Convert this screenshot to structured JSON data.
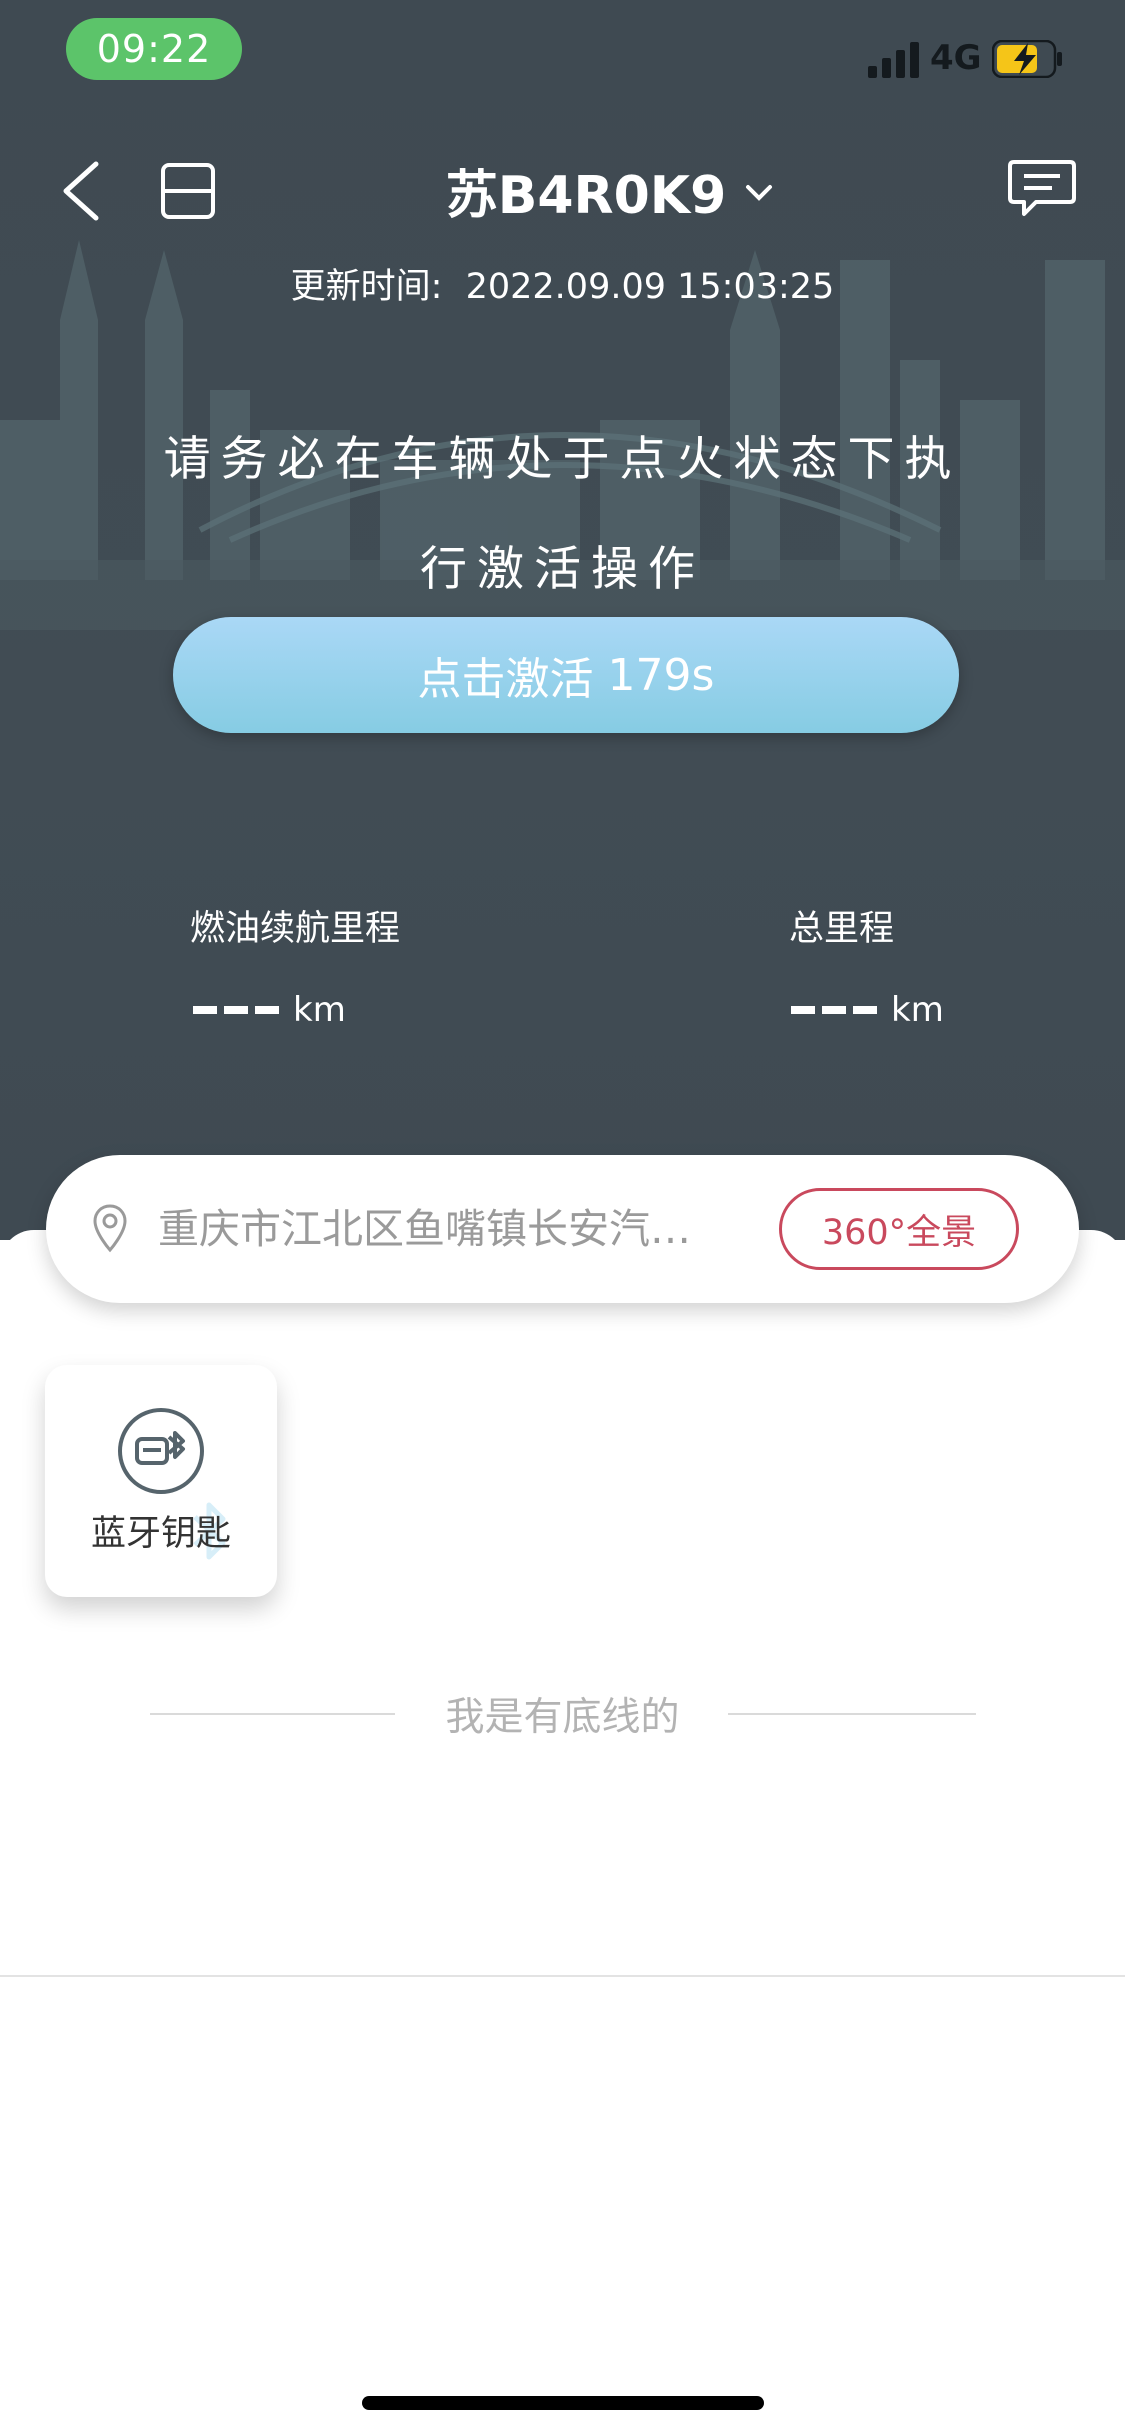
{
  "status_bar": {
    "time": "09:22",
    "network": "4G"
  },
  "header": {
    "plate": "苏B4R0K9",
    "updated_label": "更新时间:",
    "updated_value": "2022.09.09 15:03:25"
  },
  "notice": {
    "line1": "请务必在车辆处于点火状态下执",
    "line2": "行激活操作"
  },
  "activate": {
    "label": "点击激活",
    "countdown": "179s"
  },
  "stats": [
    {
      "label": "燃油续航里程",
      "unit": "km"
    },
    {
      "label": "总里程",
      "unit": "km"
    }
  ],
  "location": {
    "address": "重庆市江北区鱼嘴镇长安汽…",
    "panorama_label": "360°全景"
  },
  "bluetooth_key": {
    "label": "蓝牙钥匙"
  },
  "footer_note": "我是有底线的",
  "colors": {
    "accent": "#c9495d",
    "time_pill": "#5cc46a",
    "hero_bg": "#414c54",
    "activate_btn": "#9cd4ee"
  },
  "icons": [
    "back-icon",
    "switch-view-icon",
    "chevron-down-icon",
    "message-icon",
    "location-pin-icon",
    "bluetooth-car-icon"
  ]
}
